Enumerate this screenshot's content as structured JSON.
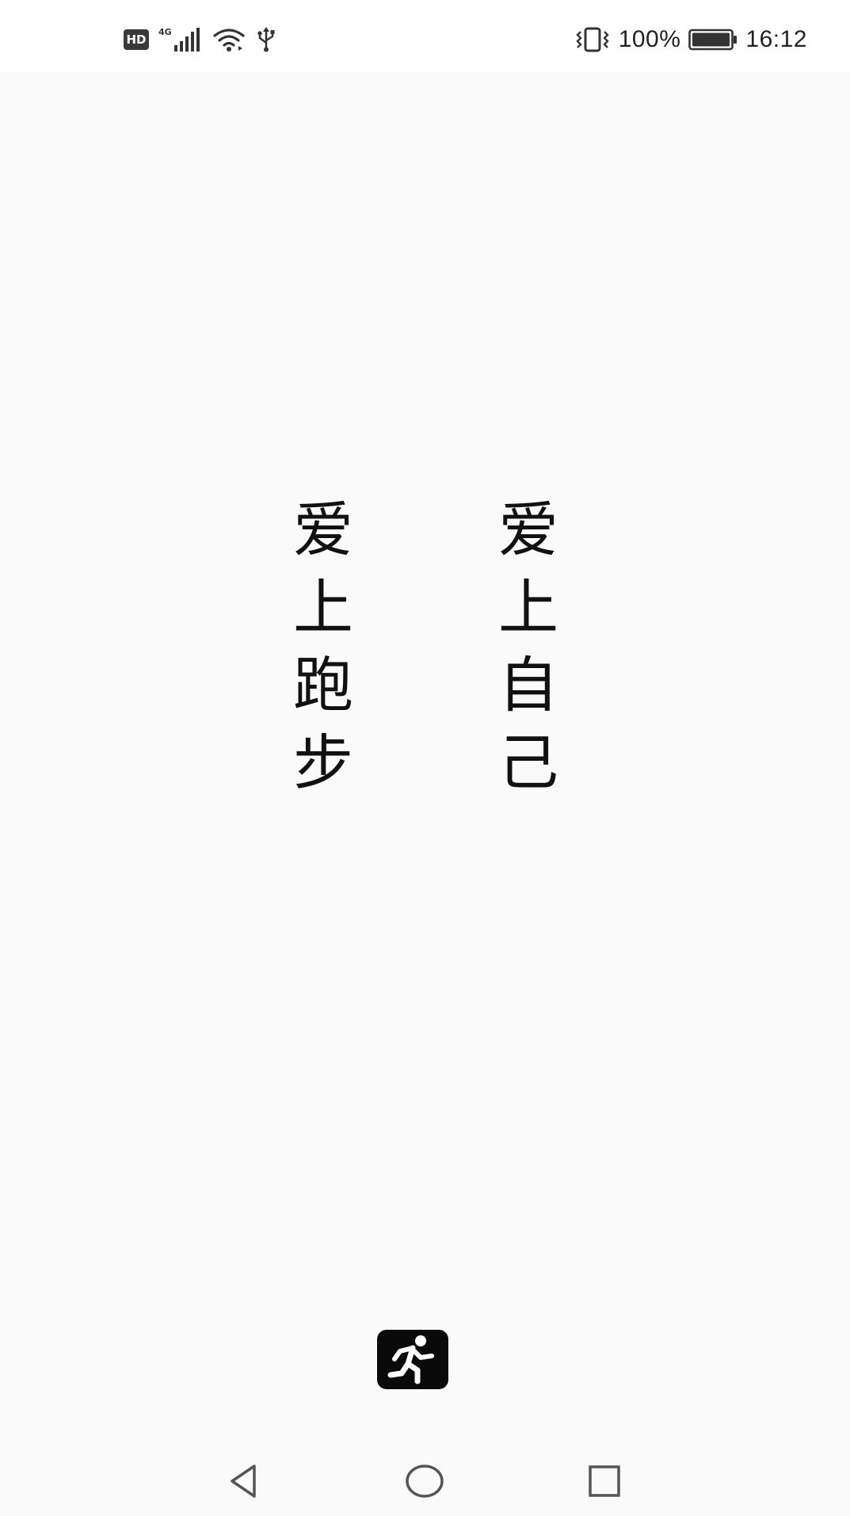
{
  "status_bar": {
    "hd_label": "HD",
    "network_type": "4G",
    "battery_percent": "100%",
    "time": "16:12",
    "icons": [
      "hd-icon",
      "signal-icon",
      "wifi-icon",
      "usb-icon",
      "vibrate-icon",
      "battery-icon"
    ]
  },
  "slogan": {
    "left_column": [
      "爱",
      "上",
      "跑",
      "步"
    ],
    "right_column": [
      "爱",
      "上",
      "自",
      "己"
    ]
  },
  "app_icon": {
    "icon": "running-person-icon"
  },
  "nav_bar": {
    "icons": [
      "back-icon",
      "home-icon",
      "recent-apps-icon"
    ]
  }
}
